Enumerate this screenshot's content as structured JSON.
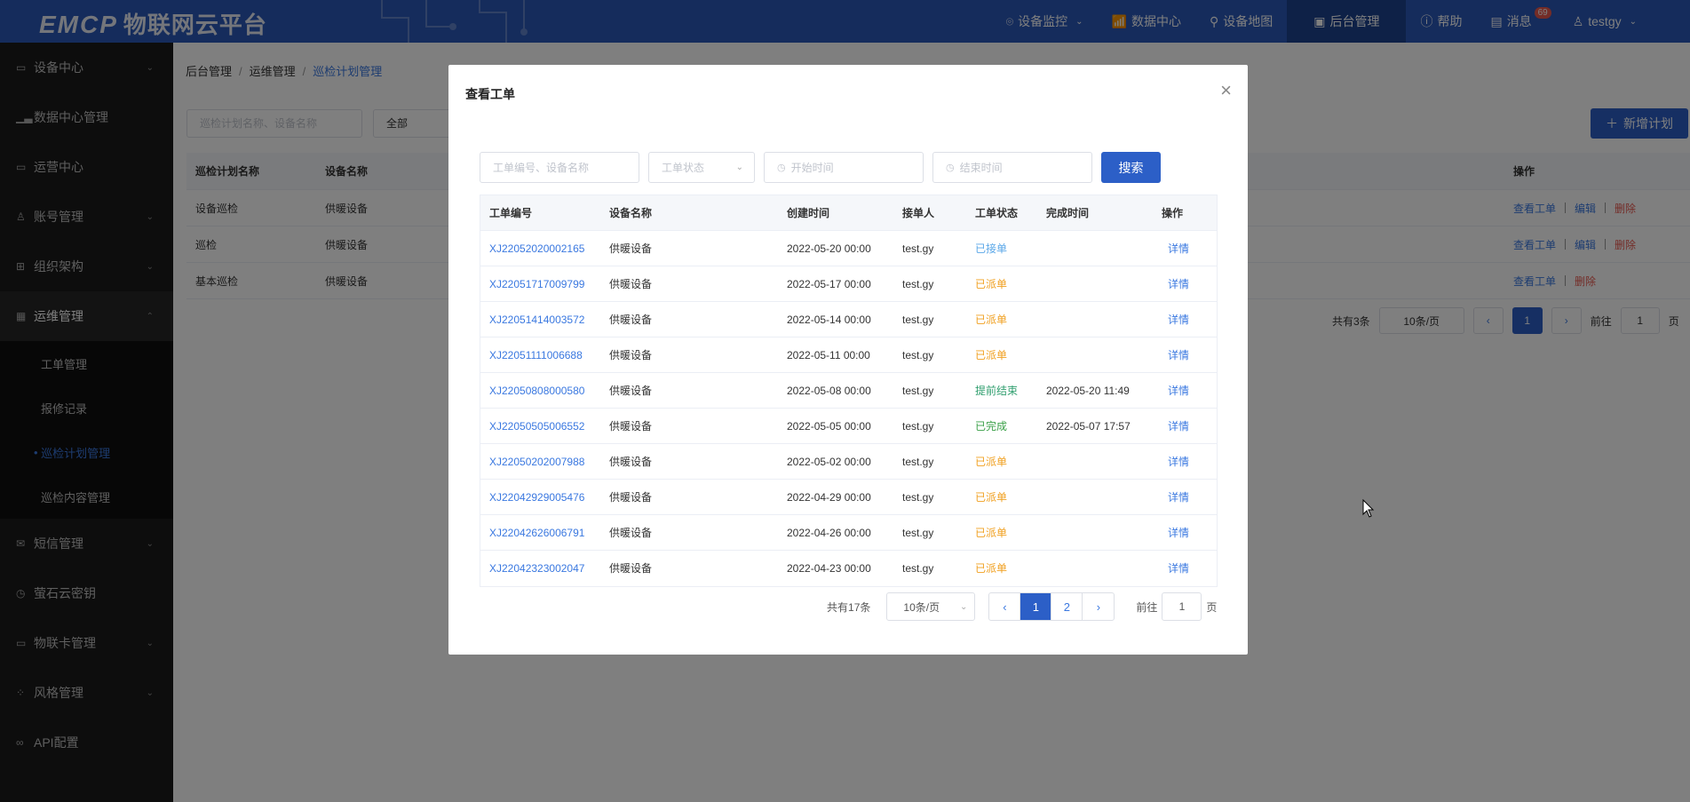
{
  "app": {
    "logo": "EMCP",
    "title": "物联网云平台"
  },
  "topnav": [
    {
      "label": "设备监控",
      "icon": "monitor-pin-icon",
      "caret": true
    },
    {
      "label": "数据中心",
      "icon": "chart-icon",
      "caret": false
    },
    {
      "label": "设备地图",
      "icon": "map-pin-icon",
      "caret": false
    },
    {
      "label": "后台管理",
      "icon": "admin-icon",
      "caret": false,
      "active": true
    },
    {
      "label": "帮助",
      "icon": "help-icon",
      "caret": false
    },
    {
      "label": "消息",
      "icon": "message-icon",
      "badge": "69"
    },
    {
      "label": "testgy",
      "icon": "user-icon",
      "caret": true
    }
  ],
  "sidebar": {
    "items": [
      {
        "label": "设备中心",
        "icon": "device-icon"
      },
      {
        "label": "数据中心管理",
        "icon": "data-icon"
      },
      {
        "label": "运营中心",
        "icon": "operation-icon"
      },
      {
        "label": "账号管理",
        "icon": "account-icon"
      },
      {
        "label": "组织架构",
        "icon": "org-icon"
      },
      {
        "label": "运维管理",
        "icon": "maintenance-icon"
      },
      {
        "label": "短信管理",
        "icon": "sms-icon"
      },
      {
        "label": "萤石云密钥",
        "icon": "key-icon"
      },
      {
        "label": "物联卡管理",
        "icon": "card-icon"
      },
      {
        "label": "风格管理",
        "icon": "style-icon"
      },
      {
        "label": "API配置",
        "icon": "api-icon"
      }
    ],
    "subitems": [
      "工单管理",
      "报修记录",
      "巡检计划管理",
      "巡检内容管理"
    ]
  },
  "breadcrumb": [
    "后台管理",
    "运维管理",
    "巡检计划管理"
  ],
  "background": {
    "search_placeholder": "巡检计划名称、设备名称",
    "select_value": "全部",
    "add_button": "新增计划",
    "columns": [
      "巡检计划名称",
      "设备名称",
      "操作"
    ],
    "rows": [
      {
        "name": "设备巡检",
        "device": "供暖设备",
        "ops": [
          "查看工单",
          "编辑",
          "删除"
        ]
      },
      {
        "name": "巡检",
        "device": "供暖设备",
        "ops": [
          "查看工单",
          "编辑",
          "删除"
        ]
      },
      {
        "name": "基本巡检",
        "device": "供暖设备",
        "ops": [
          "查看工单",
          "删除"
        ]
      }
    ],
    "pager": {
      "total": "共有3条",
      "size": "10条/页",
      "page": "1",
      "goto": "前往",
      "goto_value": "1",
      "page_unit": "页"
    }
  },
  "modal": {
    "title": "查看工单",
    "close": "×",
    "filters": {
      "keyword_placeholder": "工单编号、设备名称",
      "status_placeholder": "工单状态",
      "start_placeholder": "开始时间",
      "end_placeholder": "结束时间",
      "search_button": "搜索"
    },
    "columns": [
      "工单编号",
      "设备名称",
      "创建时间",
      "接单人",
      "工单状态",
      "完成时间",
      "操作"
    ],
    "rows": [
      {
        "id": "XJ22052020002165",
        "device": "供暖设备",
        "created": "2022-05-20 00:00",
        "receiver": "test.gy",
        "status": "已接单",
        "status_color": "#5aa7e8",
        "finished": "",
        "op": "详情"
      },
      {
        "id": "XJ22051717009799",
        "device": "供暖设备",
        "created": "2022-05-17 00:00",
        "receiver": "test.gy",
        "status": "已派单",
        "status_color": "#f0a020",
        "finished": "",
        "op": "详情"
      },
      {
        "id": "XJ22051414003572",
        "device": "供暖设备",
        "created": "2022-05-14 00:00",
        "receiver": "test.gy",
        "status": "已派单",
        "status_color": "#f0a020",
        "finished": "",
        "op": "详情"
      },
      {
        "id": "XJ22051111006688",
        "device": "供暖设备",
        "created": "2022-05-11 00:00",
        "receiver": "test.gy",
        "status": "已派单",
        "status_color": "#f0a020",
        "finished": "",
        "op": "详情"
      },
      {
        "id": "XJ22050808000580",
        "device": "供暖设备",
        "created": "2022-05-08 00:00",
        "receiver": "test.gy",
        "status": "提前结束",
        "status_color": "#2f9e6e",
        "finished": "2022-05-20 11:49",
        "op": "详情"
      },
      {
        "id": "XJ22050505006552",
        "device": "供暖设备",
        "created": "2022-05-05 00:00",
        "receiver": "test.gy",
        "status": "已完成",
        "status_color": "#3aa048",
        "finished": "2022-05-07 17:57",
        "op": "详情"
      },
      {
        "id": "XJ22050202007988",
        "device": "供暖设备",
        "created": "2022-05-02 00:00",
        "receiver": "test.gy",
        "status": "已派单",
        "status_color": "#f0a020",
        "finished": "",
        "op": "详情"
      },
      {
        "id": "XJ22042929005476",
        "device": "供暖设备",
        "created": "2022-04-29 00:00",
        "receiver": "test.gy",
        "status": "已派单",
        "status_color": "#f0a020",
        "finished": "",
        "op": "详情"
      },
      {
        "id": "XJ22042626006791",
        "device": "供暖设备",
        "created": "2022-04-26 00:00",
        "receiver": "test.gy",
        "status": "已派单",
        "status_color": "#f0a020",
        "finished": "",
        "op": "详情"
      },
      {
        "id": "XJ22042323002047",
        "device": "供暖设备",
        "created": "2022-04-23 00:00",
        "receiver": "test.gy",
        "status": "已派单",
        "status_color": "#f0a020",
        "finished": "",
        "op": "详情"
      }
    ],
    "pager": {
      "total_prefix": "共有",
      "total_count": "17",
      "total_suffix": "条",
      "size": "10条/页",
      "prev": "‹",
      "pages": [
        "1",
        "2"
      ],
      "next": "›",
      "goto": "前往",
      "goto_value": "1",
      "page_unit": "页"
    }
  }
}
